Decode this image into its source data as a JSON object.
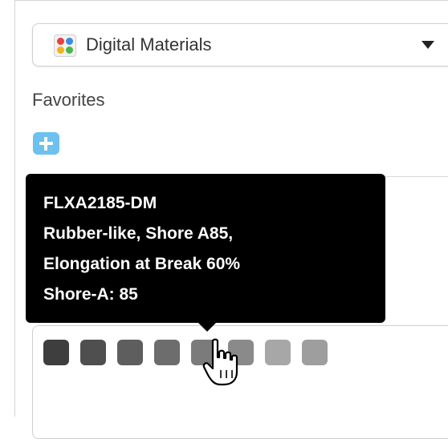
{
  "material_picker": {
    "selected": "Digital Materials",
    "icon": "digital-materials-icon",
    "icon_colors": [
      "#e8413b",
      "#3f8ae0",
      "#f3b21c",
      "#49b74a"
    ]
  },
  "favorites": {
    "label": "Favorites",
    "add_icon": "plus-icon",
    "accent": "#6cc1ee"
  },
  "tooltip": {
    "lines": [
      "FLXA2185-DM",
      "Rubber-like, Shore A85,",
      "Elongation at Break 60%",
      "Shore-A: 85"
    ]
  },
  "swatches": {
    "colors": [
      "#3e3e3e",
      "#4f4f4f",
      "#5e5e5e",
      "#6d6d6d",
      "#7b7b7b",
      "#8a8a8a",
      "#a7a7a7",
      "#9e9e9e"
    ],
    "hovered_index": 4
  },
  "cursor": "hand-pointer-icon"
}
